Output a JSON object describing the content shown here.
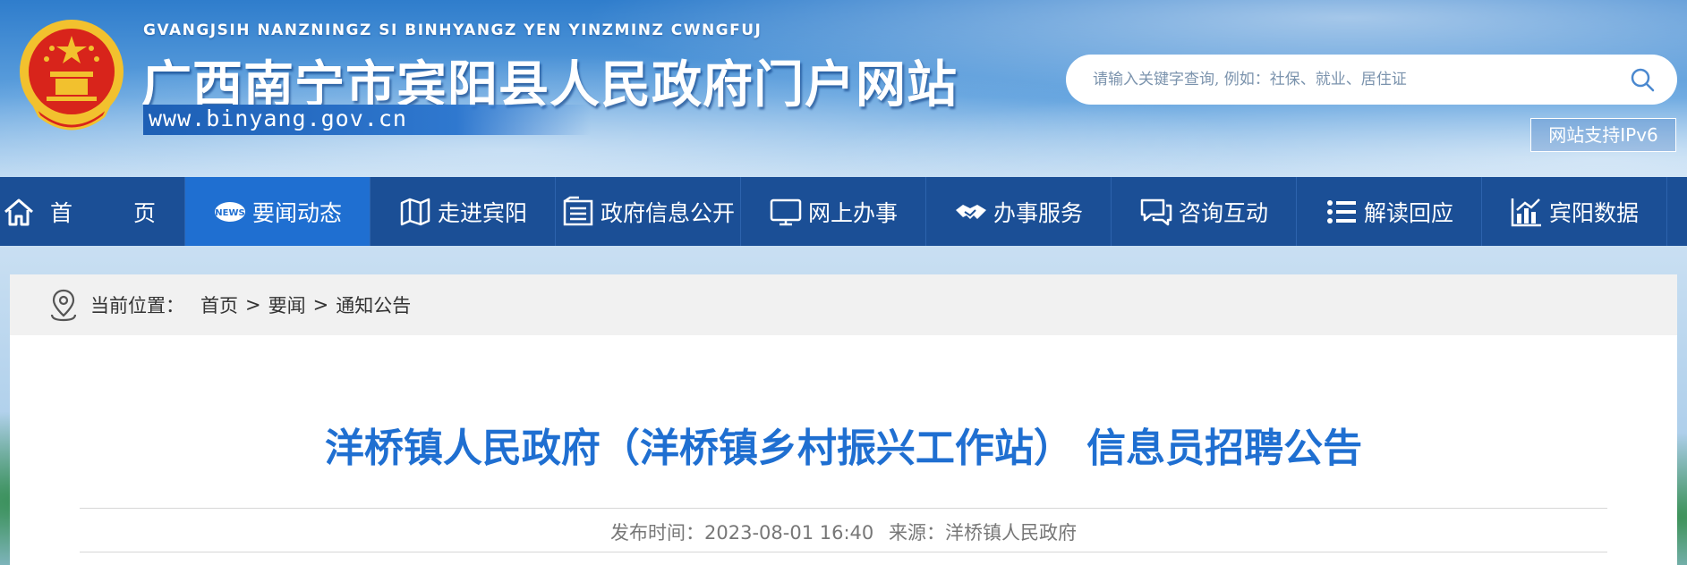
{
  "header": {
    "pinyin": "GVANGJSIH NANZNINGZ SI BINHYANGZ YEN YINZMINZ CWNGFUJ",
    "title": "广西南宁市宾阳县人民政府门户网站",
    "domain": "www.binyang.gov.cn",
    "search_placeholder": "请输入关键字查询, 例如：社保、就业、居住证",
    "ipv6_label": "网站支持IPv6"
  },
  "nav": {
    "items": [
      {
        "label": "首 页",
        "icon": "home-icon"
      },
      {
        "label": "要闻动态",
        "icon": "news-icon",
        "active": true
      },
      {
        "label": "走进宾阳",
        "icon": "map-icon"
      },
      {
        "label": "政府信息公开",
        "icon": "document-list-icon"
      },
      {
        "label": "网上办事",
        "icon": "monitor-icon"
      },
      {
        "label": "办事服务",
        "icon": "handshake-icon"
      },
      {
        "label": "咨询互动",
        "icon": "chat-icon"
      },
      {
        "label": "解读回应",
        "icon": "list-icon"
      },
      {
        "label": "宾阳数据",
        "icon": "bar-chart-icon"
      }
    ]
  },
  "breadcrumb": {
    "label": "当前位置：",
    "items": [
      "首页",
      "要闻",
      "通知公告"
    ],
    "separator": ">"
  },
  "article": {
    "title": "洋桥镇人民政府（洋桥镇乡村振兴工作站） 信息员招聘公告",
    "publish_label": "发布时间：",
    "publish_time": "2023-08-01 16:40",
    "source_label": "来源：",
    "source": "洋桥镇人民政府"
  },
  "colors": {
    "nav_bg": "#1b4f96",
    "nav_active": "#1f6fd1",
    "title_blue": "#1f6fd1",
    "emblem_red": "#d8241b",
    "emblem_gold": "#f2c12e"
  }
}
